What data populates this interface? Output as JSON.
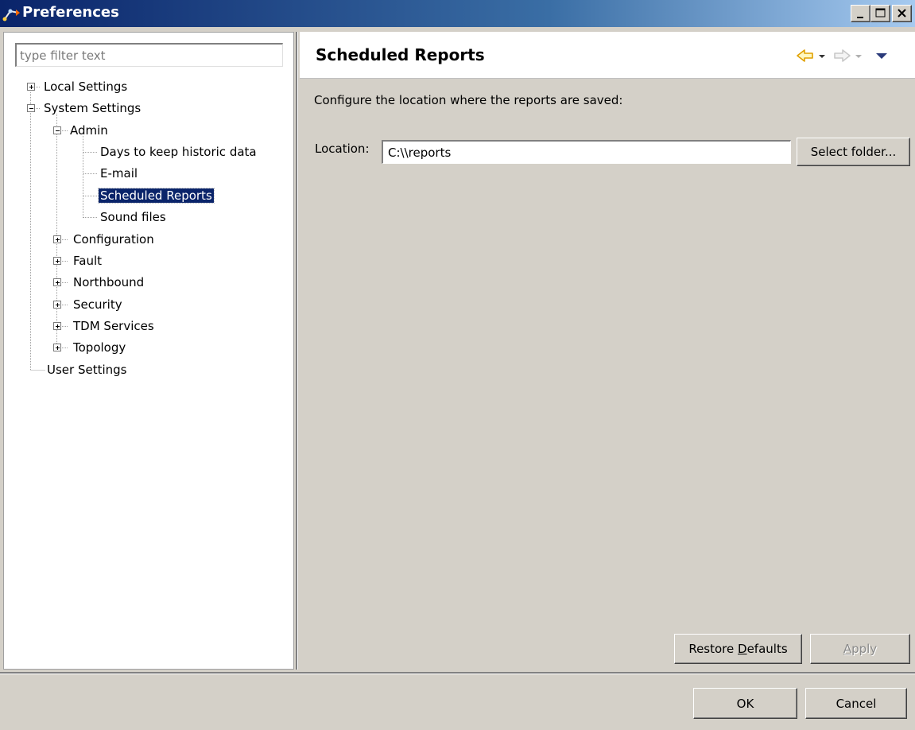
{
  "window": {
    "title": "Preferences",
    "title_icon": "eclipse-preferences-icon",
    "controls": [
      "minimize-icon",
      "maximize-icon",
      "close-icon"
    ]
  },
  "filter": {
    "placeholder": "type filter text",
    "value": ""
  },
  "tree": {
    "local_settings": "Local Settings",
    "system_settings": "System Settings",
    "admin": "Admin",
    "days_to_keep": "Days to keep historic data",
    "email": "E-mail",
    "scheduled_reports": "Scheduled Reports",
    "sound_files": "Sound files",
    "configuration": "Configuration",
    "fault": "Fault",
    "northbound": "Northbound",
    "security": "Security",
    "tdm_services": "TDM Services",
    "topology": "Topology",
    "user_settings": "User Settings"
  },
  "page": {
    "title": "Scheduled Reports",
    "description": "Configure the location where the reports are saved:",
    "location_label": "Location:",
    "location_value": "C:\\\\reports",
    "select_folder": "Select folder...",
    "restore_prefix": "Restore ",
    "restore_mnemonic": "D",
    "restore_suffix": "efaults",
    "apply_mnemonic": "A",
    "apply_suffix": "pply"
  },
  "nav": {
    "back_icon": "back-arrow-icon",
    "forward_icon": "forward-arrow-icon",
    "menu_icon": "view-menu-icon",
    "accent": "#f0b400"
  },
  "footer": {
    "ok": "OK",
    "cancel": "Cancel"
  }
}
